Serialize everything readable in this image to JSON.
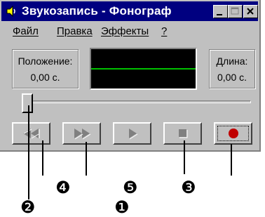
{
  "window": {
    "title": "Звукозапись - Фонограф",
    "title_controls": [
      "minimize",
      "maximize",
      "close"
    ]
  },
  "menu": [
    {
      "label": "Файл"
    },
    {
      "label": "Правка"
    },
    {
      "label": "Эффекты"
    },
    {
      "label": "?"
    }
  ],
  "position": {
    "label": "Положение:",
    "value": "0,00 с."
  },
  "length": {
    "label": "Длина:",
    "value": "0,00 с."
  },
  "waveform": {
    "line_color": "#00c000",
    "background": "#000000"
  },
  "seek_slider": {
    "value": 0
  },
  "transport": [
    {
      "name": "rewind",
      "icon": "rewind-icon",
      "enabled": false
    },
    {
      "name": "fast-forward",
      "icon": "fast-forward-icon",
      "enabled": false
    },
    {
      "name": "play",
      "icon": "play-icon",
      "enabled": false
    },
    {
      "name": "stop",
      "icon": "stop-icon",
      "enabled": false
    },
    {
      "name": "record",
      "icon": "record-icon",
      "enabled": true,
      "color": "#c00000"
    }
  ],
  "callouts": [
    "❷",
    "❹",
    "❶",
    "❺",
    "❸"
  ],
  "colors": {
    "titlebar": "#000080",
    "face": "#c0c0c0"
  }
}
